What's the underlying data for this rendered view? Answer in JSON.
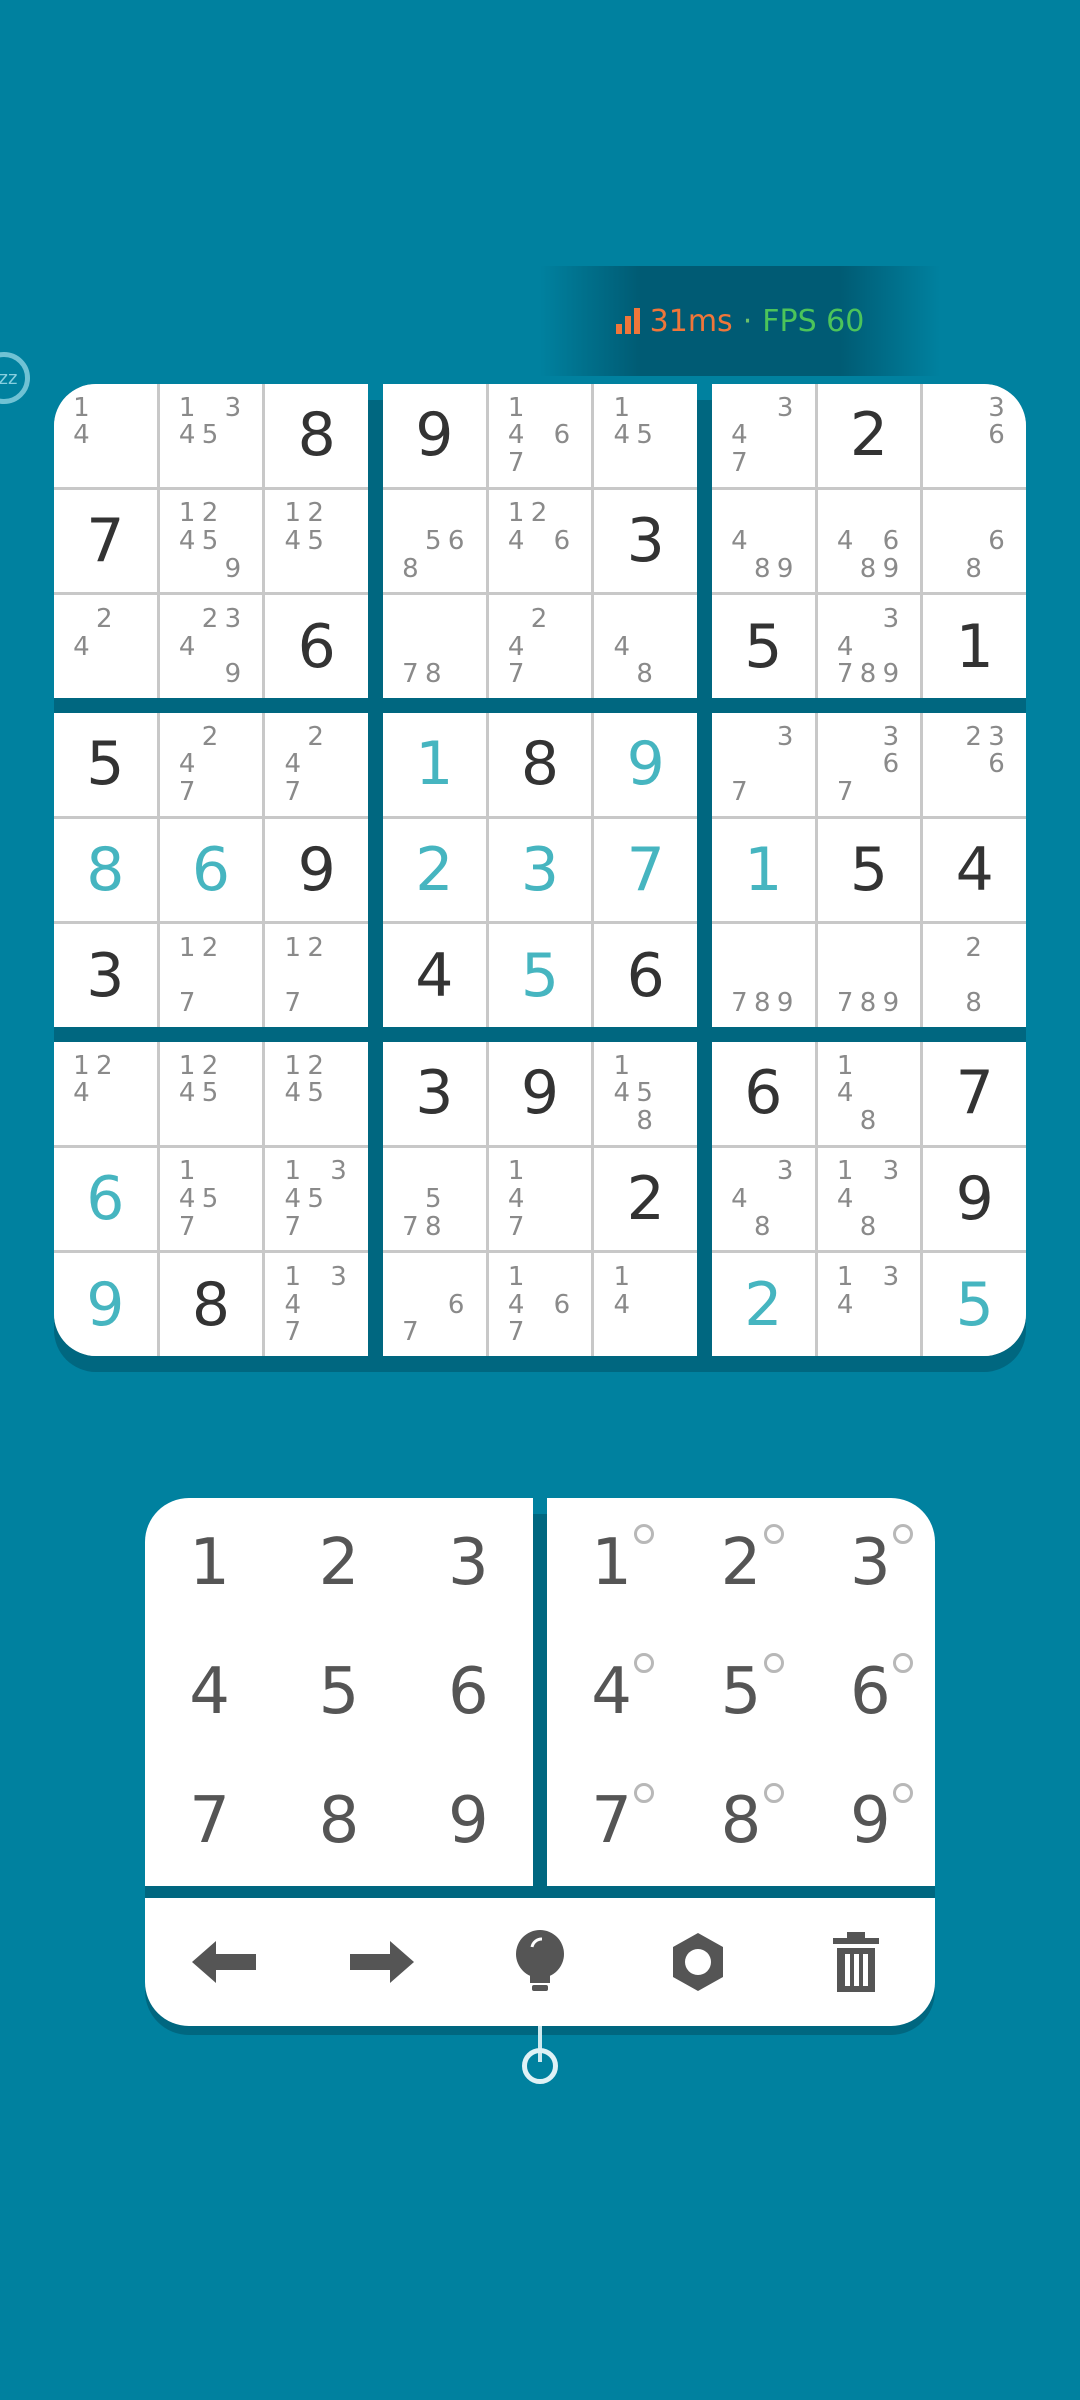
{
  "status_overlay": {
    "latency": "31ms",
    "separator": "·",
    "fps": "FPS 60",
    "colors": {
      "latency": "#f0763a",
      "fps": "#4cc45a"
    }
  },
  "sleep_badge": {
    "label": "zz"
  },
  "board": {
    "boxes": [
      [
        {
          "v": "",
          "n": [
            "1",
            "",
            "",
            "4",
            "",
            "",
            "",
            "",
            ""
          ]
        },
        {
          "v": "",
          "n": [
            "1",
            "",
            "3",
            "4",
            "5",
            "",
            "",
            "",
            ""
          ]
        },
        {
          "v": "8"
        },
        {
          "v": "7"
        },
        {
          "v": "",
          "n": [
            "1",
            "2",
            "",
            "4",
            "5",
            "",
            "",
            "",
            "9"
          ]
        },
        {
          "v": "",
          "n": [
            "1",
            "2",
            "",
            "4",
            "5",
            "",
            "",
            "",
            ""
          ]
        },
        {
          "v": "",
          "n": [
            "",
            "2",
            "",
            "4",
            "",
            "",
            "",
            "",
            ""
          ]
        },
        {
          "v": "",
          "n": [
            "",
            "2",
            "3",
            "4",
            "",
            "",
            "",
            "",
            "9"
          ]
        },
        {
          "v": "6"
        }
      ],
      [
        {
          "v": "9"
        },
        {
          "v": "",
          "n": [
            "1",
            "",
            "",
            "4",
            "",
            "6",
            "7",
            "",
            ""
          ]
        },
        {
          "v": "",
          "n": [
            "1",
            "",
            "",
            "4",
            "5",
            "",
            "",
            "",
            ""
          ]
        },
        {
          "v": "",
          "n": [
            "",
            "",
            "",
            "",
            "5",
            "6",
            "8",
            "",
            ""
          ]
        },
        {
          "v": "",
          "n": [
            "1",
            "2",
            "",
            "4",
            "",
            "6",
            "",
            "",
            ""
          ]
        },
        {
          "v": "3"
        },
        {
          "v": "",
          "n": [
            "",
            "",
            "",
            "",
            "",
            "",
            "7",
            "8",
            ""
          ]
        },
        {
          "v": "",
          "n": [
            "",
            "2",
            "",
            "4",
            "",
            "",
            "7",
            "",
            ""
          ]
        },
        {
          "v": "",
          "n": [
            "",
            "",
            "",
            "4",
            "",
            "",
            "",
            "8",
            ""
          ]
        }
      ],
      [
        {
          "v": "",
          "n": [
            "",
            "",
            "3",
            "4",
            "",
            "",
            "7",
            "",
            ""
          ]
        },
        {
          "v": "2"
        },
        {
          "v": "",
          "n": [
            "",
            "",
            "3",
            "",
            "",
            "6",
            "",
            "",
            ""
          ]
        },
        {
          "v": "",
          "n": [
            "",
            "",
            "",
            "4",
            "",
            "",
            "",
            "8",
            "9"
          ]
        },
        {
          "v": "",
          "n": [
            "",
            "",
            "",
            "4",
            "",
            "6",
            "",
            "8",
            "9"
          ]
        },
        {
          "v": "",
          "n": [
            "",
            "",
            "",
            "",
            "",
            "6",
            "",
            "8",
            ""
          ]
        },
        {
          "v": "5"
        },
        {
          "v": "",
          "n": [
            "",
            "",
            "3",
            "4",
            "",
            "",
            "7",
            "8",
            "9"
          ]
        },
        {
          "v": "1"
        }
      ],
      [
        {
          "v": "5"
        },
        {
          "v": "",
          "n": [
            "",
            "2",
            "",
            "4",
            "",
            "",
            "7",
            "",
            ""
          ]
        },
        {
          "v": "",
          "n": [
            "",
            "2",
            "",
            "4",
            "",
            "",
            "7",
            "",
            ""
          ]
        },
        {
          "v": "8",
          "u": true
        },
        {
          "v": "6",
          "u": true
        },
        {
          "v": "9"
        },
        {
          "v": "3"
        },
        {
          "v": "",
          "n": [
            "1",
            "2",
            "",
            "",
            "",
            "",
            "7",
            "",
            ""
          ]
        },
        {
          "v": "",
          "n": [
            "1",
            "2",
            "",
            "",
            "",
            "",
            "7",
            "",
            ""
          ]
        }
      ],
      [
        {
          "v": "1",
          "u": true
        },
        {
          "v": "8"
        },
        {
          "v": "9",
          "u": true
        },
        {
          "v": "2",
          "u": true
        },
        {
          "v": "3",
          "u": true
        },
        {
          "v": "7",
          "u": true
        },
        {
          "v": "4"
        },
        {
          "v": "5",
          "u": true
        },
        {
          "v": "6"
        }
      ],
      [
        {
          "v": "",
          "n": [
            "",
            "",
            "3",
            "",
            "",
            "",
            "7",
            "",
            ""
          ]
        },
        {
          "v": "",
          "n": [
            "",
            "",
            "3",
            "",
            "",
            "6",
            "7",
            "",
            ""
          ]
        },
        {
          "v": "",
          "n": [
            "",
            "2",
            "3",
            "",
            "",
            "6",
            "",
            "",
            ""
          ]
        },
        {
          "v": "1",
          "u": true
        },
        {
          "v": "5"
        },
        {
          "v": "4"
        },
        {
          "v": "",
          "n": [
            "",
            "",
            "",
            "",
            "",
            "",
            "7",
            "8",
            "9"
          ]
        },
        {
          "v": "",
          "n": [
            "",
            "",
            "",
            "",
            "",
            "",
            "7",
            "8",
            "9"
          ]
        },
        {
          "v": "",
          "n": [
            "",
            "2",
            "",
            "",
            "",
            "",
            "",
            "8",
            ""
          ]
        }
      ],
      [
        {
          "v": "",
          "n": [
            "1",
            "2",
            "",
            "4",
            "",
            "",
            "",
            "",
            ""
          ]
        },
        {
          "v": "",
          "n": [
            "1",
            "2",
            "",
            "4",
            "5",
            "",
            "",
            "",
            ""
          ]
        },
        {
          "v": "",
          "n": [
            "1",
            "2",
            "",
            "4",
            "5",
            "",
            "",
            "",
            ""
          ]
        },
        {
          "v": "6",
          "u": true
        },
        {
          "v": "",
          "n": [
            "1",
            "",
            "",
            "4",
            "5",
            "",
            "7",
            "",
            ""
          ]
        },
        {
          "v": "",
          "n": [
            "1",
            "",
            "3",
            "4",
            "5",
            "",
            "7",
            "",
            ""
          ]
        },
        {
          "v": "9",
          "u": true
        },
        {
          "v": "8"
        },
        {
          "v": "",
          "n": [
            "1",
            "",
            "3",
            "4",
            "",
            "",
            "7",
            "",
            ""
          ]
        }
      ],
      [
        {
          "v": "3"
        },
        {
          "v": "9"
        },
        {
          "v": "",
          "n": [
            "1",
            "",
            "",
            "4",
            "5",
            "",
            "",
            "8",
            ""
          ]
        },
        {
          "v": "",
          "n": [
            "",
            "",
            "",
            "",
            "5",
            "",
            "7",
            "8",
            ""
          ]
        },
        {
          "v": "",
          "n": [
            "1",
            "",
            "",
            "4",
            "",
            "",
            "7",
            "",
            ""
          ]
        },
        {
          "v": "2"
        },
        {
          "v": "",
          "n": [
            "",
            "",
            "",
            "",
            "",
            "6",
            "7",
            "",
            ""
          ]
        },
        {
          "v": "",
          "n": [
            "1",
            "",
            "",
            "4",
            "",
            "6",
            "7",
            "",
            ""
          ]
        },
        {
          "v": "",
          "n": [
            "1",
            "",
            "",
            "4",
            "",
            "",
            "",
            "",
            ""
          ]
        }
      ],
      [
        {
          "v": "6"
        },
        {
          "v": "",
          "n": [
            "1",
            "",
            "",
            "4",
            "",
            "",
            "",
            "8",
            ""
          ]
        },
        {
          "v": "7"
        },
        {
          "v": "",
          "n": [
            "",
            "",
            "3",
            "4",
            "",
            "",
            "",
            "8",
            ""
          ]
        },
        {
          "v": "",
          "n": [
            "1",
            "",
            "3",
            "4",
            "",
            "",
            "",
            "8",
            ""
          ]
        },
        {
          "v": "9"
        },
        {
          "v": "2",
          "u": true
        },
        {
          "v": "",
          "n": [
            "1",
            "",
            "3",
            "4",
            "",
            "",
            "",
            "",
            ""
          ]
        },
        {
          "v": "5",
          "u": true
        }
      ]
    ]
  },
  "keypad": {
    "numbers": [
      "1",
      "2",
      "3",
      "4",
      "5",
      "6",
      "7",
      "8",
      "9"
    ],
    "notes": [
      "1",
      "2",
      "3",
      "4",
      "5",
      "6",
      "7",
      "8",
      "9"
    ]
  },
  "toolbar": {
    "icons": [
      "arrow-left-icon",
      "arrow-right-icon",
      "hint-bulb-icon",
      "settings-gear-icon",
      "trash-icon"
    ],
    "icon_color": "#555555"
  },
  "theme": {
    "background": "#00819f",
    "user_digit": "#46b5c0",
    "given_digit": "#333333",
    "note": "#8a8a8a"
  }
}
